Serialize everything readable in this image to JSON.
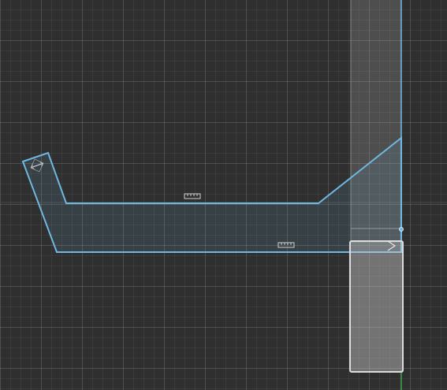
{
  "canvas": {
    "background": "#2f2f2f",
    "grid_color": "#ffffff",
    "axis_line_color": "#3b3b3b",
    "vertical_axis_color": "#3aa34a"
  },
  "selection": {
    "stroke_color": "#6fb8e0",
    "fill_color": "#6fb8e0",
    "handle_icons": [
      "ruler-icon",
      "ruler-icon",
      "resize-arrows-icon",
      "chevron-right-icon",
      "vertex-handle-icon"
    ]
  },
  "ghost_column": {
    "fill_color": "#bdbdbd"
  },
  "ghost_block": {
    "fill_color": "#c8c8c8",
    "stroke_color": "#d8d8d8"
  }
}
